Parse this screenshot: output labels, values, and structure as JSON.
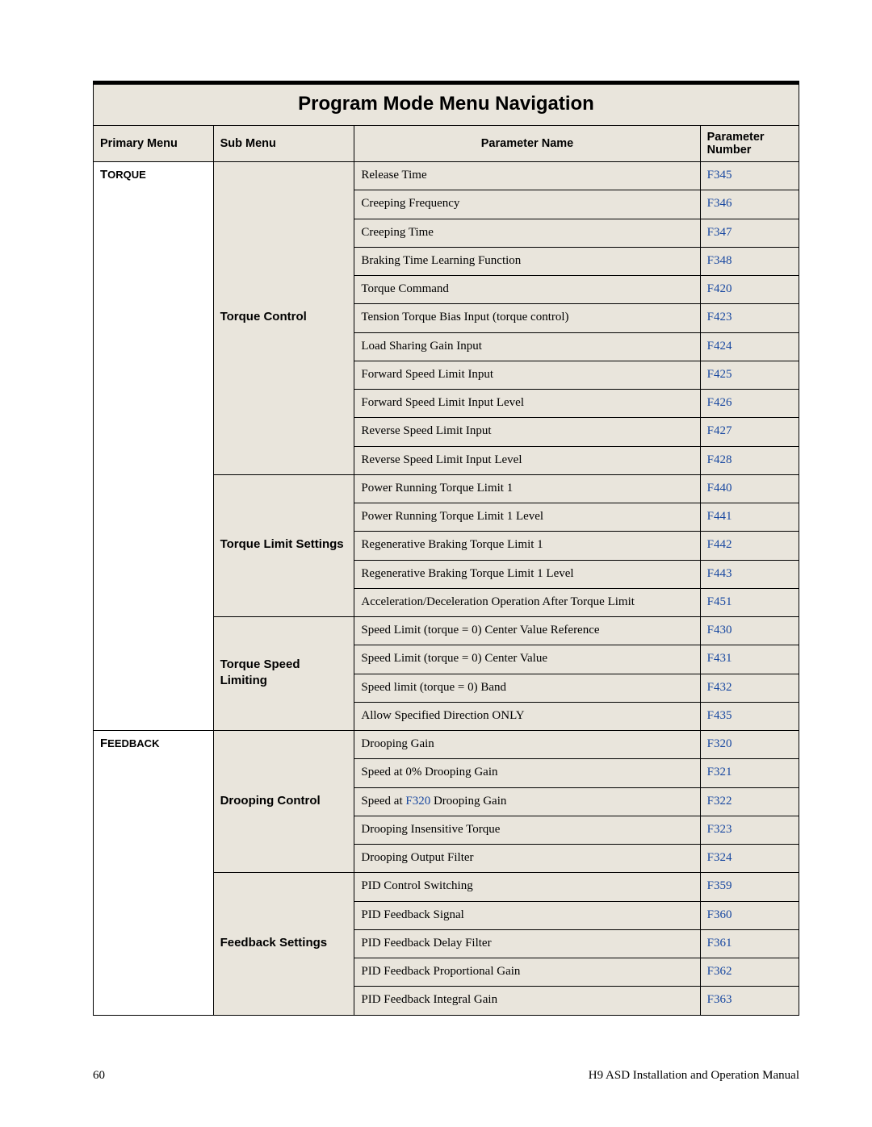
{
  "title": "Program Mode Menu Navigation",
  "headers": {
    "primary": "Primary Menu",
    "sub": "Sub Menu",
    "name": "Parameter Name",
    "num": "Parameter Number"
  },
  "groups": [
    {
      "primary_html": "T<span style=\"font-size:13px\">ORQUE</span>",
      "subs": [
        {
          "label": "Torque Control",
          "rows": [
            {
              "name": "Release Time",
              "num": "F345"
            },
            {
              "name": "Creeping Frequency",
              "num": "F346"
            },
            {
              "name": "Creeping Time",
              "num": "F347"
            },
            {
              "name": "Braking Time Learning Function",
              "num": "F348"
            },
            {
              "name": "Torque Command",
              "num": "F420"
            },
            {
              "name": "Tension Torque Bias Input (torque control)",
              "num": "F423"
            },
            {
              "name": "Load Sharing Gain Input",
              "num": "F424"
            },
            {
              "name": "Forward Speed Limit Input",
              "num": "F425"
            },
            {
              "name": "Forward Speed Limit Input Level",
              "num": "F426"
            },
            {
              "name": "Reverse Speed Limit Input",
              "num": "F427"
            },
            {
              "name": "Reverse Speed Limit Input Level",
              "num": "F428"
            }
          ]
        },
        {
          "label": "Torque Limit Settings",
          "rows": [
            {
              "name": "Power Running Torque Limit 1",
              "num": "F440"
            },
            {
              "name": "Power Running Torque Limit 1 Level",
              "num": "F441"
            },
            {
              "name": "Regenerative Braking Torque Limit 1",
              "num": "F442"
            },
            {
              "name": "Regenerative Braking Torque Limit 1 Level",
              "num": "F443"
            },
            {
              "name": "Acceleration/Deceleration Operation After Torque Limit",
              "num": "F451"
            }
          ]
        },
        {
          "label": "Torque Speed Limiting",
          "rows": [
            {
              "name": "Speed Limit (torque = 0) Center Value Reference",
              "num": "F430"
            },
            {
              "name": "Speed Limit (torque = 0) Center Value",
              "num": "F431"
            },
            {
              "name": "Speed limit (torque = 0) Band",
              "num": "F432"
            },
            {
              "name": "Allow Specified Direction ONLY",
              "num": "F435"
            }
          ]
        }
      ]
    },
    {
      "primary_html": "F<span style=\"font-size:13px\">EEDBACK</span>",
      "subs": [
        {
          "label": "Drooping Control",
          "rows": [
            {
              "name": "Drooping Gain",
              "num": "F320"
            },
            {
              "name": "Speed at 0% Drooping Gain",
              "num": "F321"
            },
            {
              "name_html": "Speed at <a class=\"fref\" href=\"#\">F320</a> Drooping Gain",
              "num": "F322"
            },
            {
              "name": "Drooping Insensitive Torque",
              "num": "F323"
            },
            {
              "name": "Drooping Output Filter",
              "num": "F324"
            }
          ]
        },
        {
          "label": "Feedback Settings",
          "rows": [
            {
              "name": "PID Control Switching",
              "num": "F359"
            },
            {
              "name": "PID Feedback Signal",
              "num": "F360"
            },
            {
              "name": "PID Feedback Delay Filter",
              "num": "F361"
            },
            {
              "name": "PID Feedback Proportional Gain",
              "num": "F362"
            },
            {
              "name": "PID Feedback Integral Gain",
              "num": "F363"
            }
          ]
        }
      ]
    }
  ],
  "footer": {
    "page": "60",
    "manual": "H9 ASD Installation and Operation Manual"
  }
}
